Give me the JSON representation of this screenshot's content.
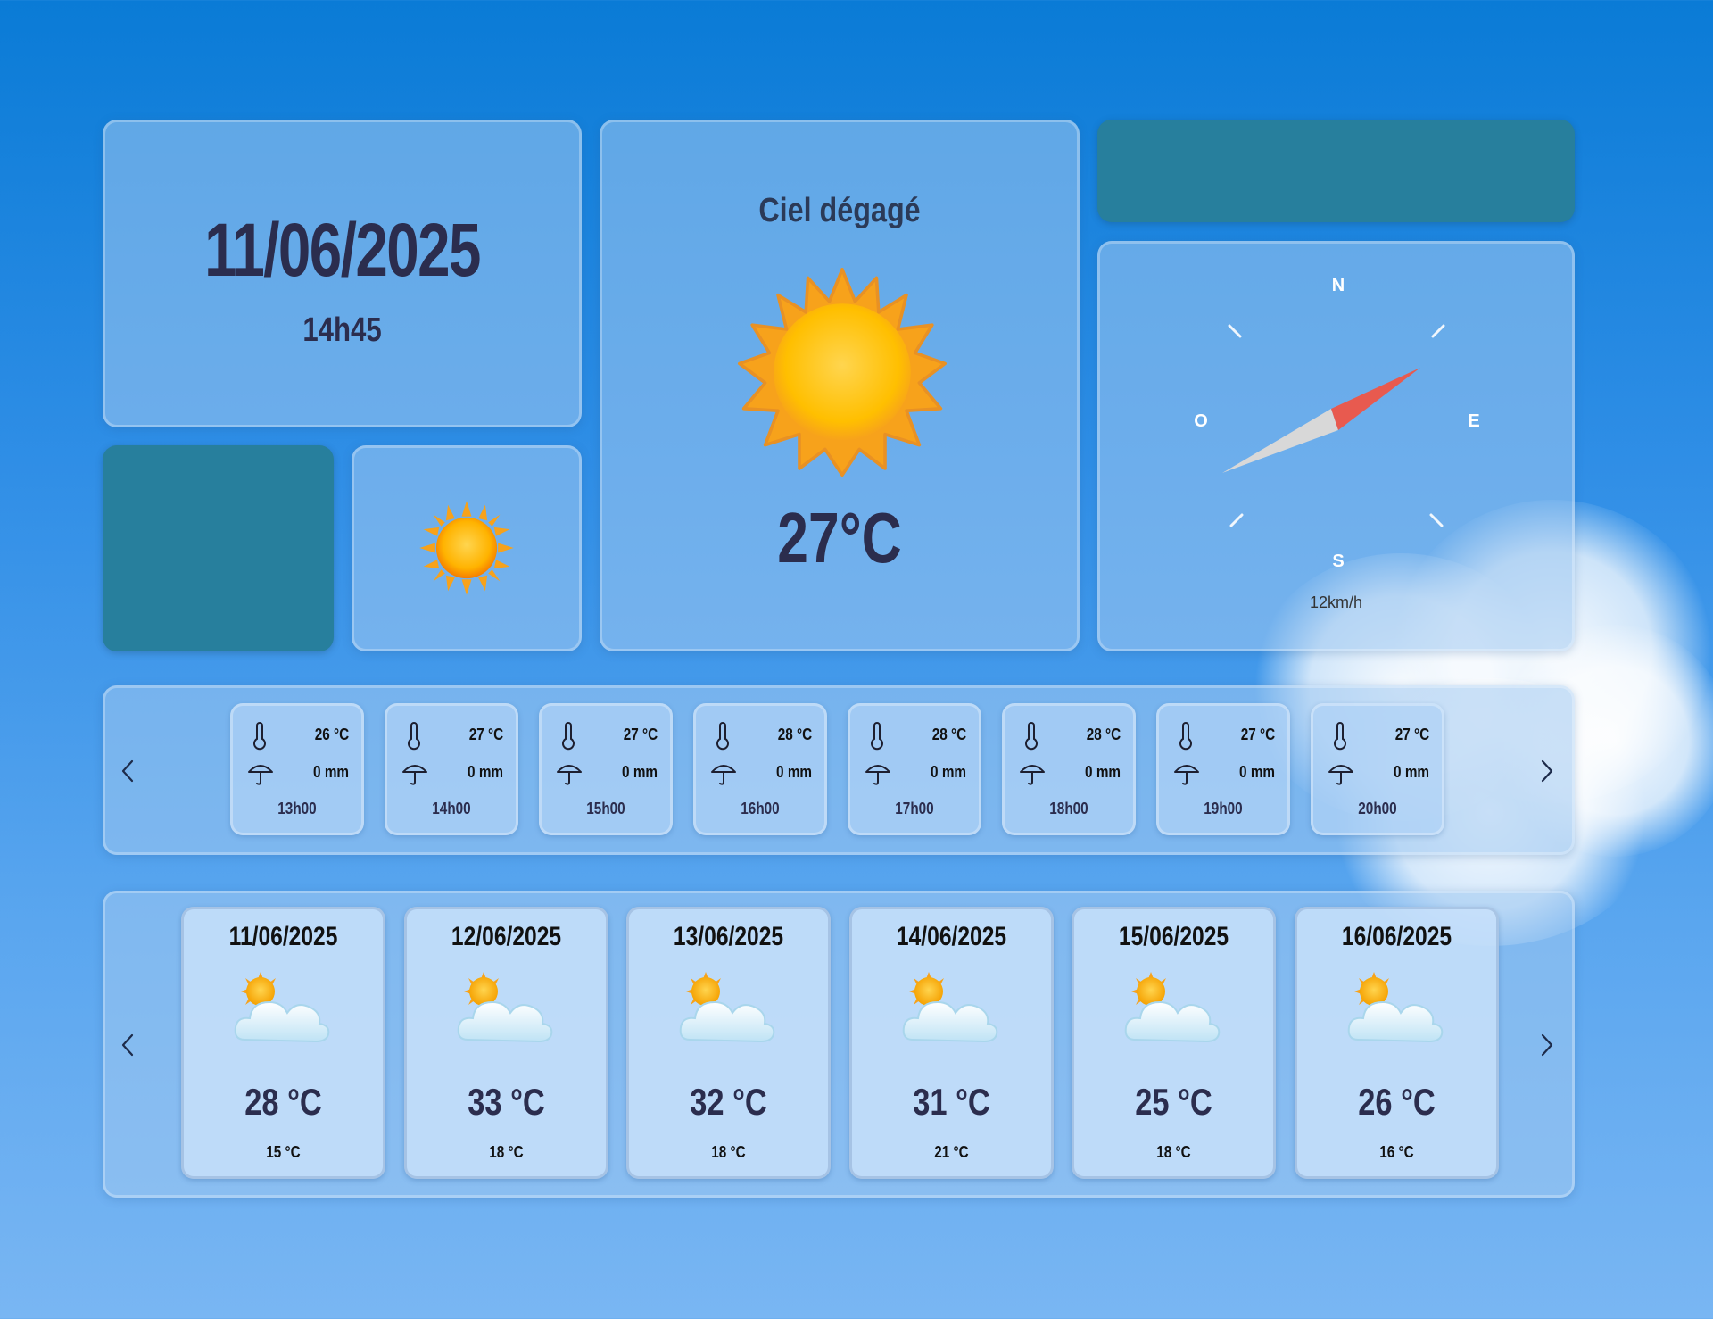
{
  "current": {
    "date": "11/06/2025",
    "time": "14h45",
    "condition": "Ciel dégagé",
    "temperature": "27°C",
    "icon": "sun-icon"
  },
  "wind": {
    "north": "N",
    "east": "E",
    "south": "S",
    "west": "O",
    "speed": "12km/h",
    "direction": "NE"
  },
  "hourly": [
    {
      "temp": "26 °C",
      "rain": "0 mm",
      "hour": "13h00"
    },
    {
      "temp": "27 °C",
      "rain": "0 mm",
      "hour": "14h00"
    },
    {
      "temp": "27 °C",
      "rain": "0 mm",
      "hour": "15h00"
    },
    {
      "temp": "28 °C",
      "rain": "0 mm",
      "hour": "16h00"
    },
    {
      "temp": "28 °C",
      "rain": "0 mm",
      "hour": "17h00"
    },
    {
      "temp": "28 °C",
      "rain": "0 mm",
      "hour": "18h00"
    },
    {
      "temp": "27 °C",
      "rain": "0 mm",
      "hour": "19h00"
    },
    {
      "temp": "27 °C",
      "rain": "0 mm",
      "hour": "20h00"
    }
  ],
  "daily": [
    {
      "date": "11/06/2025",
      "max": "28 °C",
      "min": "15 °C",
      "icon": "partly-cloudy-icon"
    },
    {
      "date": "12/06/2025",
      "max": "33 °C",
      "min": "18 °C",
      "icon": "partly-cloudy-icon"
    },
    {
      "date": "13/06/2025",
      "max": "32 °C",
      "min": "18 °C",
      "icon": "partly-cloudy-icon"
    },
    {
      "date": "14/06/2025",
      "max": "31 °C",
      "min": "21 °C",
      "icon": "partly-cloudy-icon"
    },
    {
      "date": "15/06/2025",
      "max": "25 °C",
      "min": "18 °C",
      "icon": "partly-cloudy-icon"
    },
    {
      "date": "16/06/2025",
      "max": "26 °C",
      "min": "16 °C",
      "icon": "partly-cloudy-icon"
    }
  ],
  "colors": {
    "teal_block": "#277f9d",
    "text_dark": "#2b2d4e",
    "compass_red": "#e85a4f",
    "compass_grey": "#d8d8d8",
    "sun_yellow": "#ffc107",
    "sun_orange": "#f39c12"
  },
  "nav": {
    "prev_icon": "chevron-left-icon",
    "next_icon": "chevron-right-icon"
  }
}
